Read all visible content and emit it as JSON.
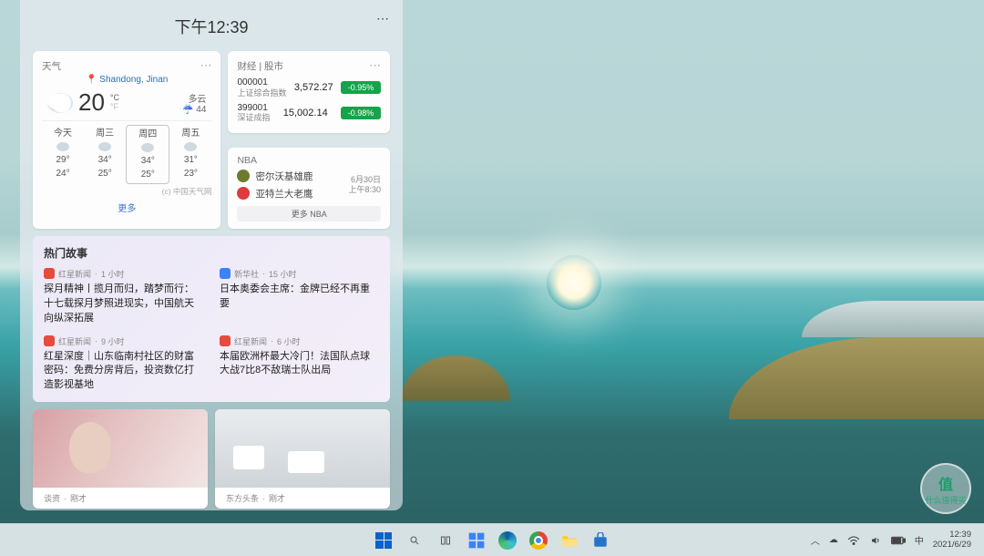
{
  "panel": {
    "time": "下午12:39",
    "more_glyph": "⋯"
  },
  "weather": {
    "title": "天气",
    "location_prefix": "📍 Shandong, Jinan",
    "temp": "20",
    "unit_top": "°C",
    "unit_bottom": "°F",
    "condition": "多云",
    "humidity": "☔ 44",
    "attribution": "(c) 中国天气网",
    "more": "更多",
    "forecast": [
      {
        "label": "今天",
        "hi": "29°",
        "lo": "24°"
      },
      {
        "label": "周三",
        "hi": "34°",
        "lo": "25°"
      },
      {
        "label": "周四",
        "hi": "34°",
        "lo": "25°"
      },
      {
        "label": "周五",
        "hi": "31°",
        "lo": "23°"
      }
    ]
  },
  "stocks": {
    "title": "财经 | 股市",
    "rows": [
      {
        "code": "000001",
        "name": "上证综合指数",
        "value": "3,572.27",
        "change": "-0.95%"
      },
      {
        "code": "399001",
        "name": "深证成指",
        "value": "15,002.14",
        "change": "-0.98%"
      }
    ]
  },
  "nba": {
    "title": "NBA",
    "team_a": "密尔沃基雄鹿",
    "team_b": "亚特兰大老鹰",
    "date": "6月30日",
    "time": "上午8:30",
    "more": "更多 NBA"
  },
  "hot": {
    "title": "热门故事",
    "stories": [
      {
        "badge": "red",
        "source": "红星新闻",
        "age": "1 小时",
        "headline": "探月精神丨揽月而归，踏梦而行：十七载探月梦照进现实，中国航天向纵深拓展"
      },
      {
        "badge": "blue",
        "source": "新华社",
        "age": "15 小时",
        "headline": "日本奥委会主席：金牌已经不再重要"
      },
      {
        "badge": "red",
        "source": "红星新闻",
        "age": "9 小时",
        "headline": "红星深度｜山东临南村社区的财富密码：免费分房背后，投资数亿打造影视基地"
      },
      {
        "badge": "red",
        "source": "红星新闻",
        "age": "6 小时",
        "headline": "本届欧洲杯最大冷门！法国队点球大战7比8不敌瑞士队出局"
      }
    ]
  },
  "tiles": [
    {
      "badge": "red",
      "source": "谈资",
      "age": "刚才"
    },
    {
      "badge": "red",
      "source": "东方头条",
      "age": "刚才"
    }
  ],
  "taskbar": {
    "chevron": "︿",
    "time": "12:39",
    "date": "2021/6/29"
  },
  "watermark": {
    "big": "值",
    "small": "什么值得买"
  },
  "colors": {
    "green": "#16a34a",
    "link": "#3b78c4"
  }
}
